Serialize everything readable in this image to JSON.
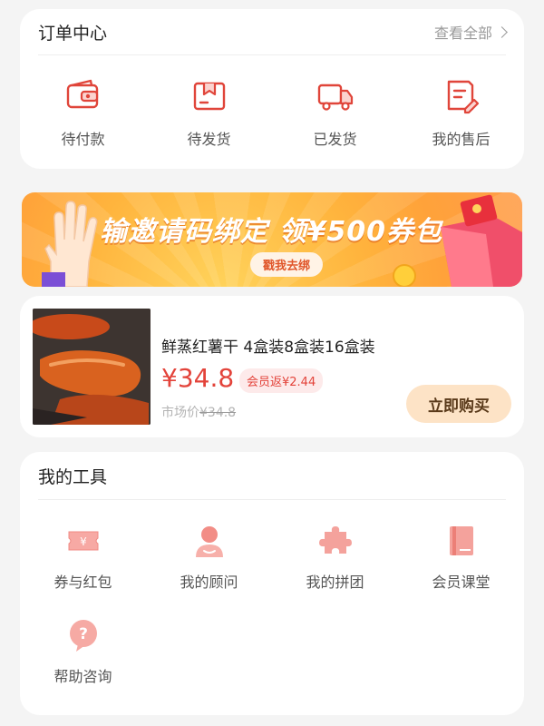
{
  "orders": {
    "title": "订单中心",
    "see_all": "查看全部",
    "items": [
      {
        "label": "待付款",
        "icon": "wallet-icon"
      },
      {
        "label": "待发货",
        "icon": "package-icon"
      },
      {
        "label": "已发货",
        "icon": "truck-icon"
      },
      {
        "label": "我的售后",
        "icon": "aftersale-icon"
      }
    ]
  },
  "banner": {
    "text": "输邀请码绑定 领¥500券包",
    "button": "戳我去绑"
  },
  "product": {
    "name": "鲜蒸红薯干 4盒装8盒装16盒装",
    "price": "¥34.8",
    "rebate": "会员返¥2.44",
    "market_label": "市场价",
    "market_price": "¥34.8",
    "buy_label": "立即购买"
  },
  "tools": {
    "title": "我的工具",
    "items": [
      {
        "label": "券与红包",
        "icon": "coupon-icon"
      },
      {
        "label": "我的顾问",
        "icon": "advisor-icon"
      },
      {
        "label": "我的拼团",
        "icon": "puzzle-icon"
      },
      {
        "label": "会员课堂",
        "icon": "book-icon"
      },
      {
        "label": "帮助咨询",
        "icon": "help-icon"
      }
    ]
  },
  "colors": {
    "accent": "#e3433a",
    "icon_red": "#e0453a",
    "buy_bg": "#fde3c6",
    "banner_orange": "#ffb43d"
  }
}
